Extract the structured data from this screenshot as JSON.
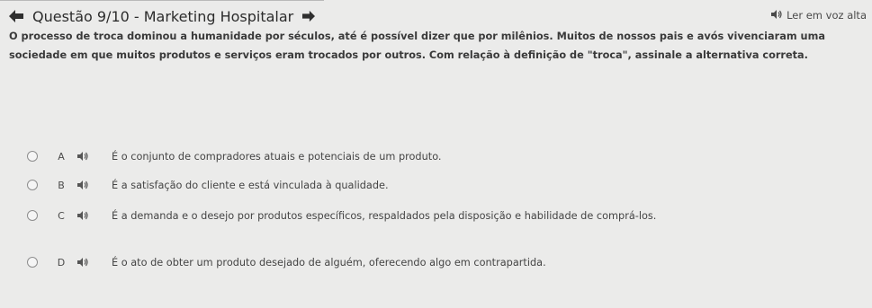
{
  "header": {
    "title": "Questão 9/10 - Marketing Hospitalar",
    "back_icon": "arrow-left-icon",
    "next_icon": "arrow-right-icon"
  },
  "read_aloud": {
    "label": "Ler em voz alta",
    "icon": "speaker-icon"
  },
  "question": {
    "text": "O processo de troca dominou a humanidade por séculos, até é possível dizer que por milênios. Muitos de nossos pais e avós vivenciaram uma sociedade em que muitos produtos e serviços eram trocados por outros. Com relação à definição de \"troca\", assinale a alternativa correta."
  },
  "options": [
    {
      "letter": "A",
      "text": "É o conjunto de compradores atuais e potenciais de um produto."
    },
    {
      "letter": "B",
      "text": "É a satisfação do cliente e está vinculada à qualidade."
    },
    {
      "letter": "C",
      "text": "É a demanda e o desejo por produtos específicos, respaldados pela disposição e habilidade de comprá-los."
    },
    {
      "letter": "D",
      "text": "É o ato de obter um produto desejado de alguém, oferecendo algo em contrapartida."
    }
  ]
}
